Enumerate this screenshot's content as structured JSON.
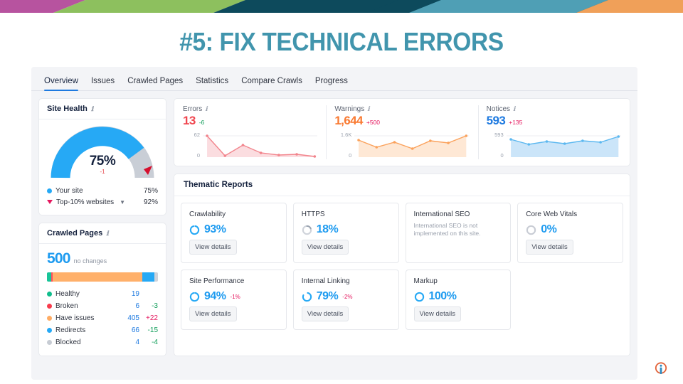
{
  "slide": {
    "headline": "#5: FIX TECHNICAL ERRORS",
    "headline_color": "#4195ad",
    "banner_colors": [
      "#b7539f",
      "#8dc05e",
      "#0d4a5c",
      "#4f9fb5",
      "#f0a059"
    ]
  },
  "tabs": [
    {
      "label": "Overview",
      "active": true
    },
    {
      "label": "Issues",
      "active": false
    },
    {
      "label": "Crawled Pages",
      "active": false
    },
    {
      "label": "Statistics",
      "active": false
    },
    {
      "label": "Compare Crawls",
      "active": false
    },
    {
      "label": "Progress",
      "active": false
    }
  ],
  "site_health": {
    "title": "Site Health",
    "value": "75%",
    "delta": "-1",
    "gauge_percent": 75,
    "legend": [
      {
        "label": "Your site",
        "value": "75%",
        "marker": "dot",
        "color": "#1e9bf0"
      },
      {
        "label": "Top-10% websites",
        "value": "92%",
        "marker": "triangle",
        "color": "#e5175e",
        "chevron": "⌄"
      }
    ]
  },
  "crawled_pages": {
    "title": "Crawled Pages",
    "total": "500",
    "subtitle": "no changes",
    "bar_segments": [
      {
        "color": "#18c498",
        "pct": 3.8
      },
      {
        "color": "#ff4d5e",
        "pct": 1.2
      },
      {
        "color": "#ffb06a",
        "pct": 81.0
      },
      {
        "color": "#26a9f5",
        "pct": 11.0
      },
      {
        "color": "#cfd3da",
        "pct": 3.0
      }
    ],
    "rows": [
      {
        "label": "Healthy",
        "color": "#0fbd8c",
        "count": "19",
        "delta": ""
      },
      {
        "label": "Broken",
        "color": "#f83b4c",
        "count": "6",
        "delta": "-3",
        "delta_sign": "neg"
      },
      {
        "label": "Have issues",
        "color": "#ffac64",
        "count": "405",
        "delta": "+22",
        "delta_sign": "pos"
      },
      {
        "label": "Redirects",
        "color": "#26a9f5",
        "count": "66",
        "delta": "-15",
        "delta_sign": "neg"
      },
      {
        "label": "Blocked",
        "color": "#c7ccd4",
        "count": "4",
        "delta": "-4",
        "delta_sign": "neg"
      }
    ]
  },
  "stats": [
    {
      "title": "Errors",
      "value": "13",
      "delta": "-6",
      "delta_color": "#0f9d58",
      "value_color": "#f0464f",
      "axis_top": "62",
      "axis_bottom": "0",
      "line_color": "#f2848c",
      "fill_color": "rgba(246,180,186,0.45)",
      "points": [
        62,
        9,
        28,
        13,
        9,
        10,
        6
      ]
    },
    {
      "title": "Warnings",
      "value": "1,644",
      "delta": "+500",
      "delta_color": "#e5175e",
      "value_color": "#f97a32",
      "axis_top": "1.6K",
      "axis_bottom": "0",
      "line_color": "#fba25c",
      "fill_color": "rgba(253,214,178,0.55)",
      "points": [
        1390,
        980,
        1240,
        900,
        1330,
        1230,
        1640
      ]
    },
    {
      "title": "Notices",
      "value": "593",
      "delta": "+135",
      "delta_color": "#e5175e",
      "value_color": "#1e7ae0",
      "axis_top": "593",
      "axis_bottom": "0",
      "line_color": "#5cb8f0",
      "fill_color": "rgba(190,223,247,0.75)",
      "points": [
        500,
        430,
        470,
        440,
        478,
        455,
        572
      ]
    }
  ],
  "thematic_reports": {
    "title": "Thematic Reports",
    "button_label": "View details",
    "items": [
      {
        "name": "Crawlability",
        "percent": "93%",
        "ring": 93,
        "ring_color": "#26a9f5",
        "delta": "",
        "note": "",
        "has_button": true
      },
      {
        "name": "HTTPS",
        "percent": "18%",
        "ring": 18,
        "ring_color": "#9aa3b0",
        "delta": "",
        "note": "",
        "has_button": true
      },
      {
        "name": "International SEO",
        "percent": "",
        "ring": 0,
        "ring_color": "",
        "delta": "",
        "note": "International SEO is not implemented on this site.",
        "has_button": false
      },
      {
        "name": "Core Web Vitals",
        "percent": "0%",
        "ring": 0,
        "ring_color": "#c8ccd4",
        "delta": "",
        "note": "",
        "has_button": true
      },
      {
        "name": "Site Performance",
        "percent": "94%",
        "ring": 94,
        "ring_color": "#26a9f5",
        "delta": "-1%",
        "note": "",
        "has_button": true
      },
      {
        "name": "Internal Linking",
        "percent": "79%",
        "ring": 79,
        "ring_color": "#26a9f5",
        "delta": "-2%",
        "note": "",
        "has_button": true
      },
      {
        "name": "Markup",
        "percent": "100%",
        "ring": 100,
        "ring_color": "#26a9f5",
        "delta": "",
        "note": "",
        "has_button": true
      }
    ]
  },
  "logo": {
    "name": "info-logo",
    "ring_color": "#e2633a",
    "mark_color": "#2e8bc0"
  }
}
